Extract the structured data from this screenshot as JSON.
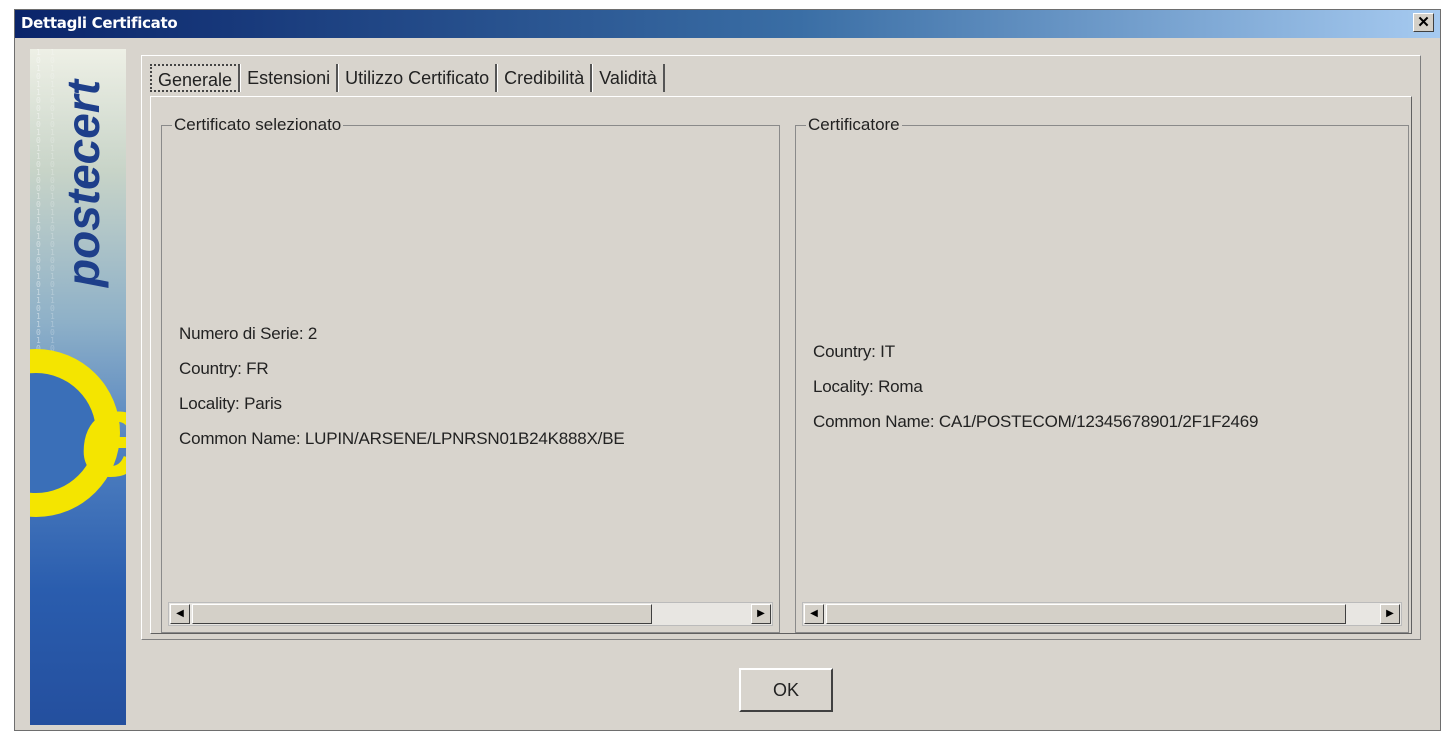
{
  "window": {
    "title": "Dettagli Certificato",
    "close_label": "✕"
  },
  "logo": {
    "text": "postecert",
    "binary": "1010110010101101001011010100101101101001011010010110101001"
  },
  "tabs": [
    {
      "label": "Generale",
      "active": true
    },
    {
      "label": "Estensioni",
      "active": false
    },
    {
      "label": "Utilizzo Certificato",
      "active": false
    },
    {
      "label": "Credibilità",
      "active": false
    },
    {
      "label": "Validità",
      "active": false
    }
  ],
  "selected_certificate": {
    "legend": "Certificato selezionato",
    "fields": [
      "Numero di Serie: 2",
      "Country: FR",
      "Locality: Paris",
      "Common Name: LUPIN/ARSENE/LPNRSN01B24K888X/BE"
    ]
  },
  "issuer": {
    "legend": "Certificatore",
    "fields": [
      "Country: IT",
      "Locality: Roma",
      "Common Name: CA1/POSTECOM/12345678901/2F1F2469"
    ]
  },
  "scroll": {
    "left_arrow": "◀",
    "right_arrow": "▶"
  },
  "ok_label": "OK"
}
